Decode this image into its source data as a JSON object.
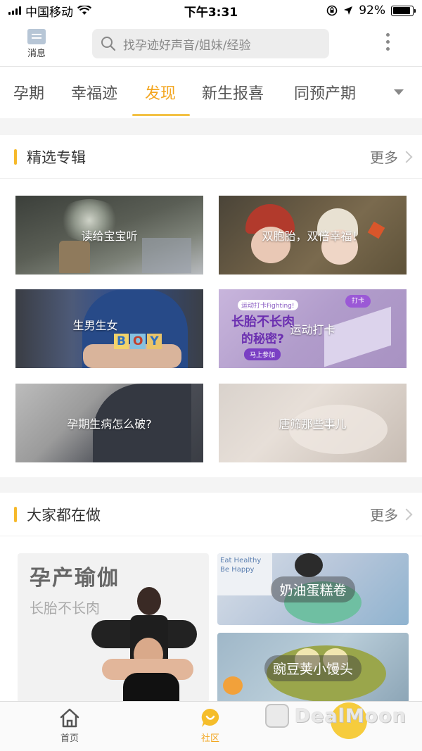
{
  "status_bar": {
    "carrier": "中国移动",
    "time": "下午3:31",
    "battery": "92%",
    "battery_level": 0.92
  },
  "header": {
    "message_label": "消息",
    "search_placeholder": "找孕迹好声音/姐妹/经验"
  },
  "tabs": [
    {
      "label": "孕期",
      "active": false
    },
    {
      "label": "幸福迹",
      "active": false
    },
    {
      "label": "发现",
      "active": true
    },
    {
      "label": "新生报喜",
      "active": false
    },
    {
      "label": "同预产期",
      "active": false
    }
  ],
  "featured": {
    "title": "精选专辑",
    "more": "更多",
    "albums": [
      {
        "label": "读给宝宝听"
      },
      {
        "label": "双胞胎，双倍幸福！"
      },
      {
        "label": "生男生女",
        "blocks": "BOY"
      },
      {
        "label": "运动打卡",
        "banner_tag": "运动打卡Fighting!",
        "banner_headline": "长胎不长肉",
        "banner_headline2": "的秘密?",
        "banner_button": "马上参加",
        "banner_badge": "打卡"
      },
      {
        "label": "孕期生病怎么破?"
      },
      {
        "label": "唐筛那些事儿"
      }
    ]
  },
  "doing": {
    "title": "大家都在做",
    "more": "更多",
    "yoga": {
      "title": "孕产瑜伽",
      "subtitle": "长胎不长肉"
    },
    "cards": [
      {
        "label": "奶油蛋糕卷",
        "mug_text": "Eat Healthy Be Happy"
      },
      {
        "label": "豌豆荚小馒头"
      }
    ]
  },
  "bottom_nav": {
    "home": "首页",
    "community": "社区",
    "watermark": "DealMoon"
  },
  "colors": {
    "accent": "#f3a620",
    "section_bar": "#f6b92b"
  }
}
